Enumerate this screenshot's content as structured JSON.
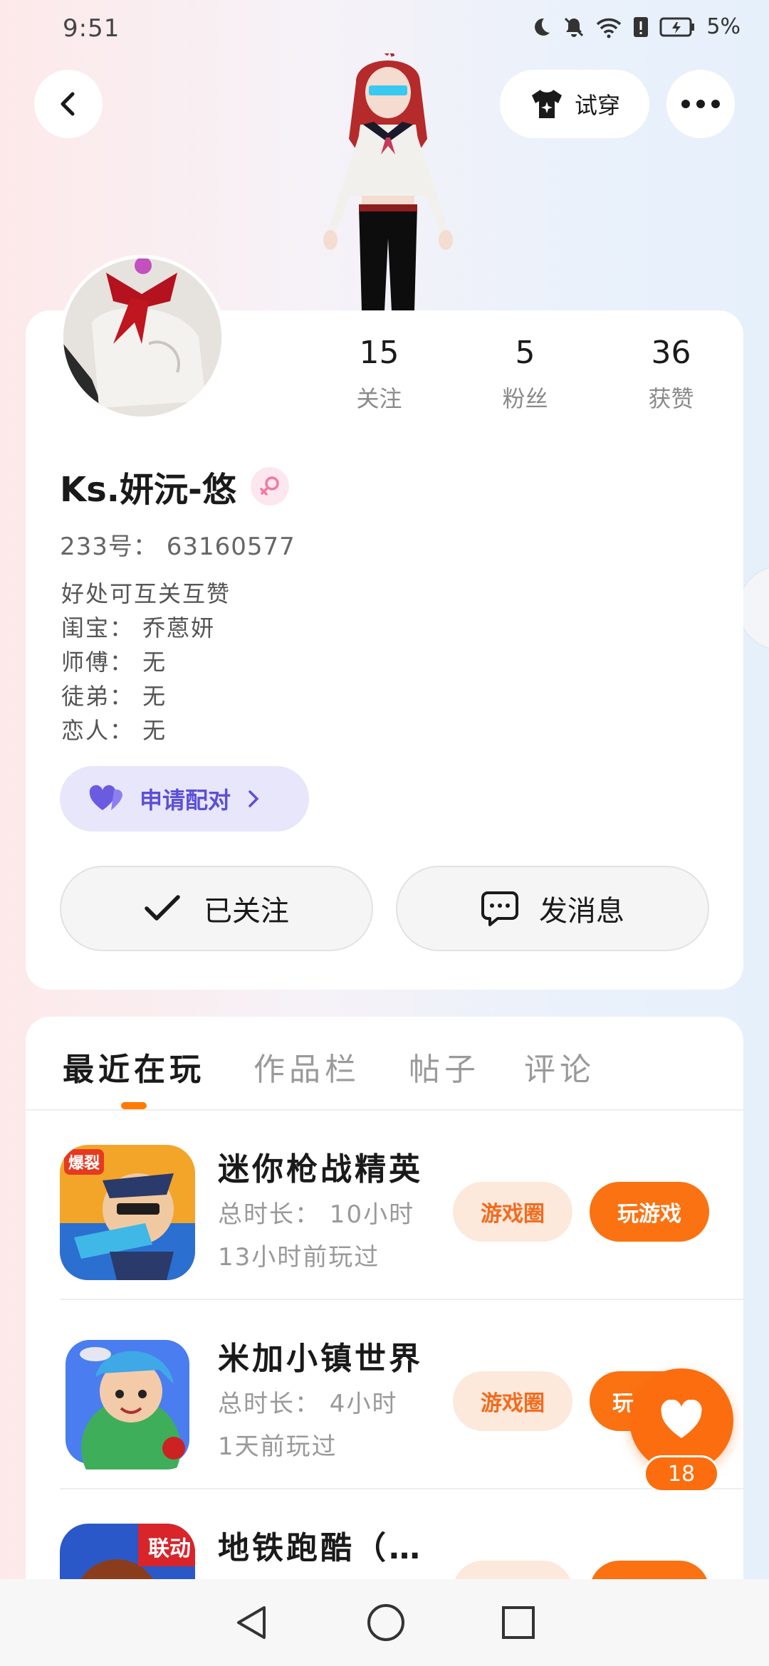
{
  "status_bar": {
    "time": "9:51",
    "battery": "5%"
  },
  "header": {
    "tryon_label": "试穿"
  },
  "profile": {
    "stats": [
      {
        "value": "15",
        "label": "关注"
      },
      {
        "value": "5",
        "label": "粉丝"
      },
      {
        "value": "36",
        "label": "获赞"
      }
    ],
    "username": "Ks.妍沅-悠",
    "gender": "female",
    "uid": "233号： 63160577",
    "bio": [
      "好处可互关互赞",
      "闺宝： 乔蒽妍",
      "师傅： 无",
      "徒弟： 无",
      "恋人： 无"
    ],
    "pair_label": "申请配对",
    "follow_label": "已关注",
    "message_label": "发消息"
  },
  "tabs": [
    {
      "label": "最近在玩",
      "active": true
    },
    {
      "label": "作品栏",
      "active": false
    },
    {
      "label": "帖子",
      "active": false
    },
    {
      "label": "评论",
      "active": false
    }
  ],
  "games": [
    {
      "name": "迷你枪战精英",
      "total_time": "总时长： 10小时",
      "last_played": "13小时前玩过",
      "icon_badge": "爆裂",
      "circle_label": "游戏圈",
      "play_label": "玩游戏"
    },
    {
      "name": "米加小镇世界",
      "total_time": "总时长： 4小时",
      "last_played": "1天前玩过",
      "icon_badge": "",
      "circle_label": "游戏圈",
      "play_label": "玩"
    },
    {
      "name": "地铁跑酷（…",
      "total_time": "",
      "last_played": "",
      "icon_badge": "联动",
      "circle_label": "",
      "play_label": ""
    }
  ],
  "like": {
    "count": "18"
  },
  "colors": {
    "accent": "#fa7212",
    "pair": "#5b50d6"
  }
}
